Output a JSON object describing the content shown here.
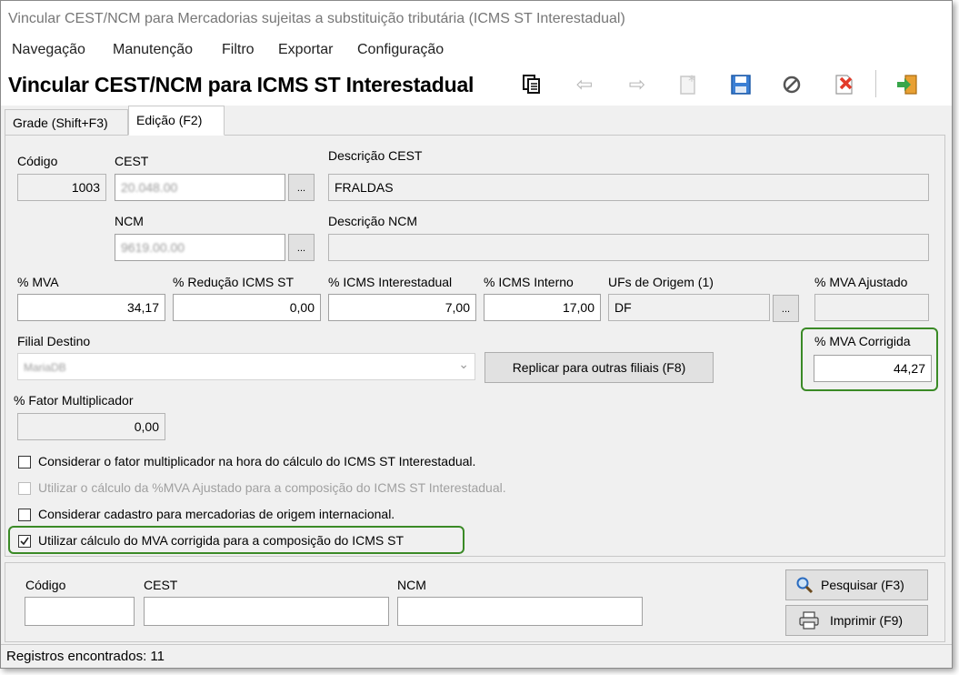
{
  "window": {
    "title": "Vincular CEST/NCM para Mercadorias sujeitas a substituição tributária (ICMS ST Interestadual)"
  },
  "menu": [
    "Navegação",
    "Manutenção",
    "Filtro",
    "Exportar",
    "Configuração"
  ],
  "toolbar": {
    "title": "Vincular CEST/NCM para ICMS ST Interestadual",
    "icons": [
      "copy-icon",
      "back-arrow-icon",
      "forward-arrow-icon",
      "new-icon",
      "save-icon",
      "cancel-icon",
      "delete-icon",
      "exit-icon"
    ]
  },
  "tabs": {
    "grid": "Grade (Shift+F3)",
    "edit": "Edição (F2)"
  },
  "form": {
    "codigo_label": "Código",
    "codigo_value": "1003",
    "cest_label": "CEST",
    "cest_value": "20.048.00",
    "desc_cest_label": "Descrição CEST",
    "desc_cest_value": "FRALDAS",
    "ncm_label": "NCM",
    "ncm_value": "9619.00.00",
    "desc_ncm_label": "Descrição NCM",
    "desc_ncm_value": "",
    "ellipsis": "...",
    "mva_label": "% MVA",
    "mva_value": "34,17",
    "reducao_label": "% Redução ICMS ST",
    "reducao_value": "0,00",
    "icms_inter_label": "% ICMS Interestadual",
    "icms_inter_value": "7,00",
    "icms_interno_label": "% ICMS Interno",
    "icms_interno_value": "17,00",
    "ufs_label": "UFs de Origem (1)",
    "ufs_value": "DF",
    "mva_ajustado_label": "% MVA Ajustado",
    "mva_ajustado_value": "",
    "filial_label": "Filial Destino",
    "filial_value": "MariaDB",
    "replicar_button": "Replicar para outras filiais (F8)",
    "mva_corrigida_label": "% MVA Corrigida",
    "mva_corrigida_value": "44,27",
    "fator_label": "% Fator Multiplicador",
    "fator_value": "0,00"
  },
  "checkboxes": [
    {
      "label": "Considerar o fator multiplicador na hora do cálculo do ICMS ST Interestadual.",
      "checked": false,
      "enabled": true
    },
    {
      "label": "Utilizar o cálculo da %MVA Ajustado para a composição do ICMS ST Interestadual.",
      "checked": false,
      "enabled": false
    },
    {
      "label": "Considerar cadastro para mercadorias de origem internacional.",
      "checked": false,
      "enabled": true
    },
    {
      "label": "Utilizar cálculo do MVA corrigida para a composição do ICMS ST",
      "checked": true,
      "enabled": true
    }
  ],
  "search": {
    "codigo_label": "Código",
    "cest_label": "CEST",
    "ncm_label": "NCM",
    "pesquisar_button": "Pesquisar (F3)",
    "imprimir_button": "Imprimir (F9)"
  },
  "status": {
    "text": "Registros encontrados: 11"
  },
  "colors": {
    "highlight": "#3a8a26",
    "window_bg": "#f0f0f0"
  }
}
